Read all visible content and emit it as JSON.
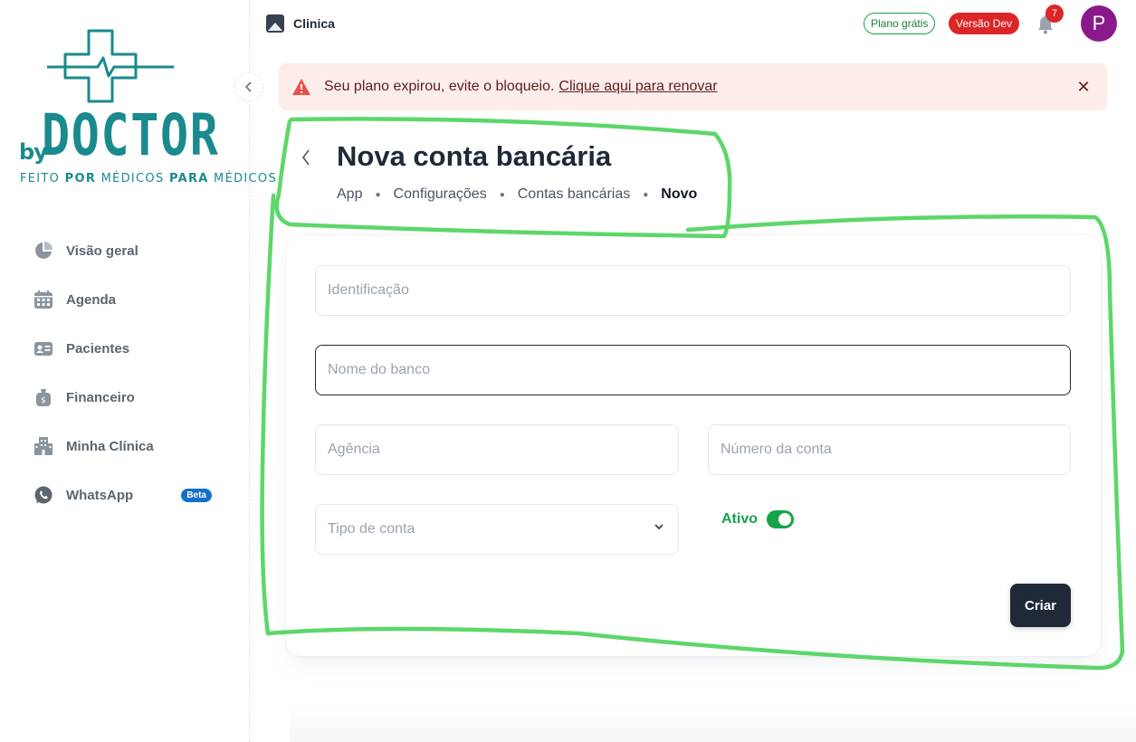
{
  "brand": {
    "by": "by",
    "name": "DOCTOR",
    "tagline_parts": [
      "FEITO ",
      "POR",
      " MÉDICOS ",
      "PARA",
      " MÉDICOS"
    ]
  },
  "sidebar": {
    "items": [
      {
        "label": "Visão geral",
        "icon": "pie-chart-icon"
      },
      {
        "label": "Agenda",
        "icon": "calendar-icon"
      },
      {
        "label": "Pacientes",
        "icon": "id-card-icon"
      },
      {
        "label": "Financeiro",
        "icon": "money-bag-icon"
      },
      {
        "label": "Minha Clínica",
        "icon": "building-icon"
      },
      {
        "label": "WhatsApp",
        "icon": "whatsapp-icon",
        "badge": "Beta"
      }
    ]
  },
  "topbar": {
    "clinic_name": "Clinica",
    "plan_badge": "Plano grátis",
    "version_badge": "Versão Dev",
    "notification_count": "7",
    "avatar_letter": "P"
  },
  "alert": {
    "text": "Seu plano expirou, evite o bloqueio.",
    "link": "Clique aqui para renovar",
    "close": "✕"
  },
  "page": {
    "title": "Nova conta bancária",
    "breadcrumb": [
      "App",
      "Configurações",
      "Contas bancárias",
      "Novo"
    ]
  },
  "form": {
    "identificacao_placeholder": "Identificação",
    "banco_placeholder": "Nome do banco",
    "agencia_placeholder": "Agência",
    "numero_placeholder": "Número da conta",
    "tipo_placeholder": "Tipo de conta",
    "ativo_label": "Ativo",
    "ativo_value": true,
    "submit_label": "Criar"
  },
  "colors": {
    "brand": "#1a8a8e",
    "alert_bg": "#fcecea",
    "success": "#16a34a",
    "danger": "#dc2626",
    "primary_button": "#1f2937",
    "annotation": "#5dd66a"
  }
}
